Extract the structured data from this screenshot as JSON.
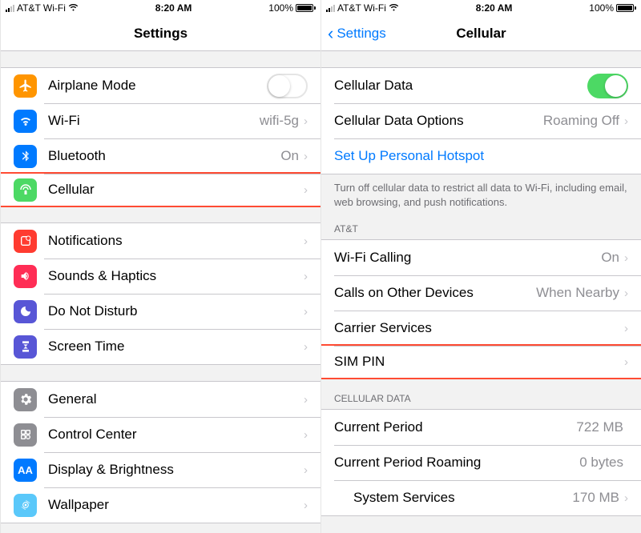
{
  "status": {
    "carrier": "AT&T Wi-Fi",
    "time": "8:20 AM",
    "battery_pct": "100%"
  },
  "left": {
    "title": "Settings",
    "rows": {
      "airplane": "Airplane Mode",
      "wifi": "Wi-Fi",
      "wifi_val": "wifi-5g",
      "bluetooth": "Bluetooth",
      "bluetooth_val": "On",
      "cellular": "Cellular",
      "notifications": "Notifications",
      "sounds": "Sounds & Haptics",
      "dnd": "Do Not Disturb",
      "screentime": "Screen Time",
      "general": "General",
      "control": "Control Center",
      "display": "Display & Brightness",
      "wallpaper": "Wallpaper"
    }
  },
  "right": {
    "back": "Settings",
    "title": "Cellular",
    "rows": {
      "cell_data": "Cellular Data",
      "cell_opts": "Cellular Data Options",
      "cell_opts_val": "Roaming Off",
      "hotspot": "Set Up Personal Hotspot",
      "footer1": "Turn off cellular data to restrict all data to Wi-Fi, including email, web browsing, and push notifications.",
      "header_att": "AT&T",
      "wifi_calling": "Wi-Fi Calling",
      "wifi_calling_val": "On",
      "calls_other": "Calls on Other Devices",
      "calls_other_val": "When Nearby",
      "carrier_services": "Carrier Services",
      "sim_pin": "SIM PIN",
      "header_cd": "CELLULAR DATA",
      "cur_period": "Current Period",
      "cur_period_val": "722 MB",
      "cur_roam": "Current Period Roaming",
      "cur_roam_val": "0 bytes",
      "sys_services": "System Services",
      "sys_services_val": "170 MB"
    }
  },
  "colors": {
    "orange": "#ff9500",
    "blue": "#007aff",
    "bt": "#007aff",
    "green": "#4cd964",
    "red": "#ff3b30",
    "pink": "#ff2d55",
    "purple": "#5856d6",
    "gray": "#8e8e93"
  }
}
